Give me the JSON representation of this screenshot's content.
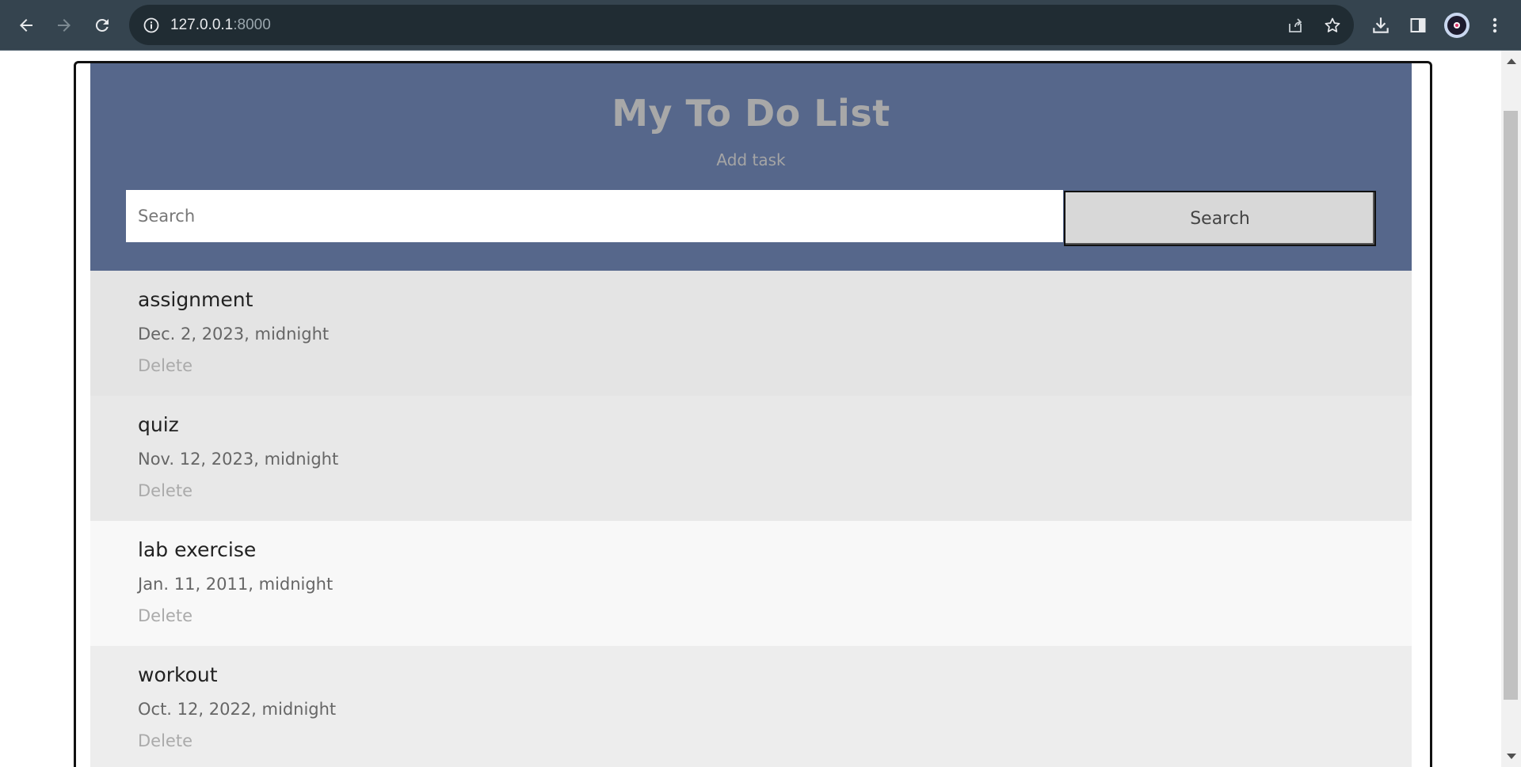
{
  "browser": {
    "url_host": "127.0.0.1",
    "url_port": ":8000"
  },
  "page": {
    "title": "My To Do List",
    "add_task_label": "Add task",
    "search": {
      "placeholder": "Search",
      "value": "",
      "button_label": "Search"
    },
    "tasks": [
      {
        "title": "assignment",
        "date": "Dec. 2, 2023, midnight",
        "delete_label": "Delete",
        "bg": "#e4e4e4"
      },
      {
        "title": "quiz",
        "date": "Nov. 12, 2023, midnight",
        "delete_label": "Delete",
        "bg": "#e8e8e8"
      },
      {
        "title": "lab exercise",
        "date": "Jan. 11, 2011, midnight",
        "delete_label": "Delete",
        "bg": "#f8f8f8"
      },
      {
        "title": "workout",
        "date": "Oct. 12, 2022, midnight",
        "delete_label": "Delete",
        "bg": "#ededed"
      }
    ]
  },
  "colors": {
    "chrome_bg": "#35444f",
    "header_bg": "#56678b",
    "title_text": "#a8a8a8"
  }
}
